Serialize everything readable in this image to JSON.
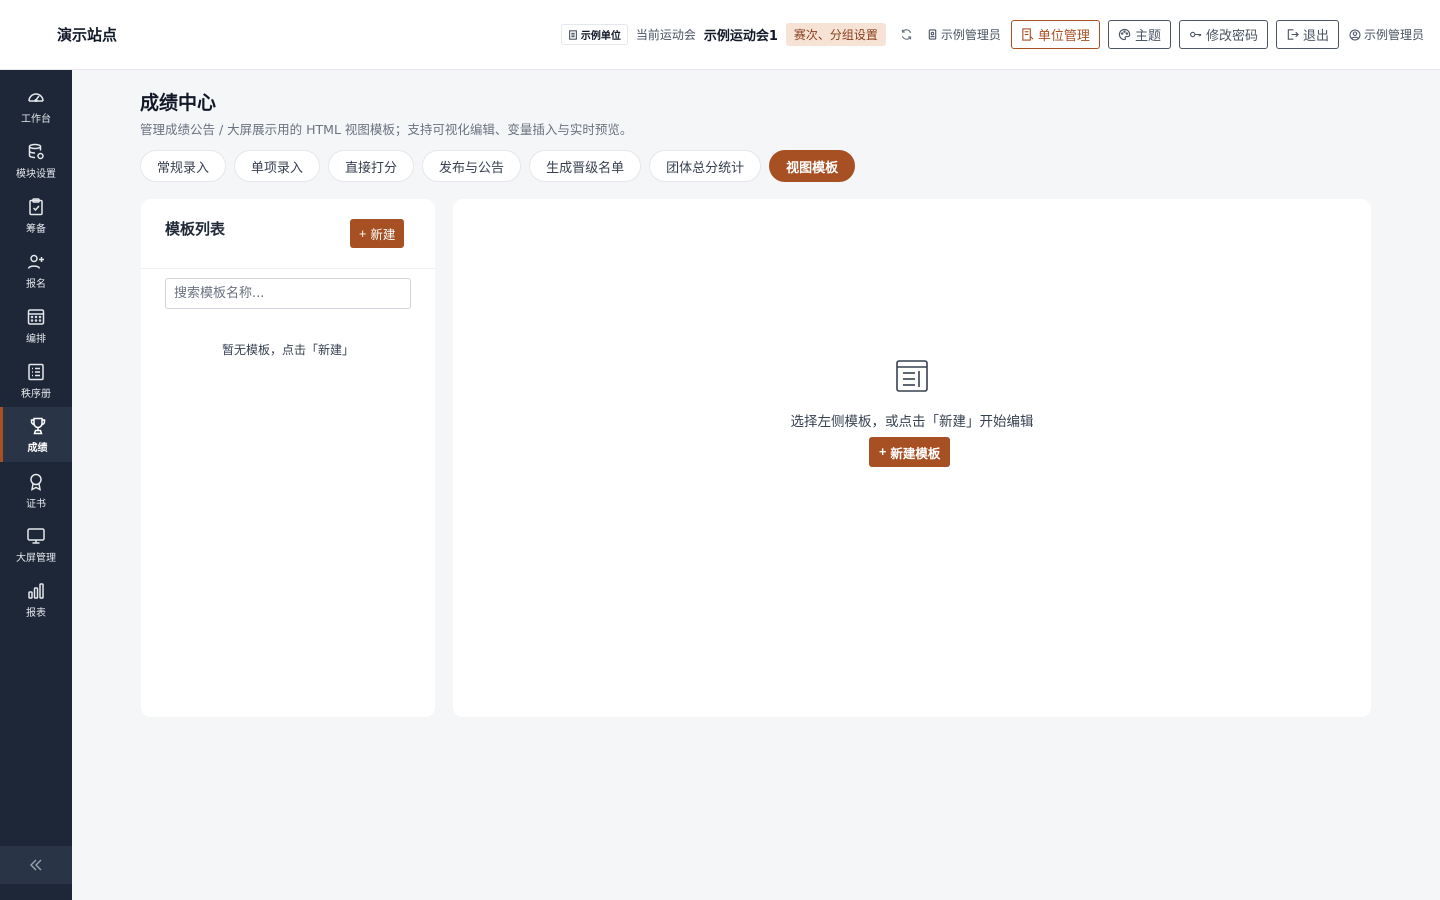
{
  "header": {
    "site_name": "演示站点",
    "unit_chip": "示例单位",
    "current_meet_label": "当前运动会",
    "current_meet_name": "示例运动会1",
    "round_chip": "赛次、分组设置",
    "admin_link": "示例管理员",
    "btn_unit_manage": "单位管理",
    "btn_theme": "主题",
    "btn_change_password": "修改密码",
    "btn_logout": "退出",
    "user_name": "示例管理员"
  },
  "sidebar": {
    "items": [
      {
        "label": "工作台",
        "icon": "dashboard-icon"
      },
      {
        "label": "模块设置",
        "icon": "database-icon"
      },
      {
        "label": "筹备",
        "icon": "clipboard-icon"
      },
      {
        "label": "报名",
        "icon": "user-plus-icon"
      },
      {
        "label": "编排",
        "icon": "calendar-icon"
      },
      {
        "label": "秩序册",
        "icon": "list-icon"
      },
      {
        "label": "成绩",
        "icon": "trophy-icon",
        "active": true
      },
      {
        "label": "证书",
        "icon": "award-icon"
      },
      {
        "label": "大屏管理",
        "icon": "monitor-icon"
      },
      {
        "label": "报表",
        "icon": "bar-chart-icon"
      }
    ],
    "collapse_icon": "double-chevron-left-icon"
  },
  "page": {
    "title": "成绩中心",
    "description": "管理成绩公告 / 大屏展示用的 HTML 视图模板；支持可视化编辑、变量插入与实时预览。"
  },
  "tabs": [
    {
      "label": "常规录入"
    },
    {
      "label": "单项录入"
    },
    {
      "label": "直接打分"
    },
    {
      "label": "发布与公告"
    },
    {
      "label": "生成晋级名单"
    },
    {
      "label": "团体总分统计"
    },
    {
      "label": "视图模板",
      "active": true
    }
  ],
  "template_list": {
    "title": "模板列表",
    "new_button": "新建",
    "search_placeholder": "搜索模板名称...",
    "empty_text": "暂无模板，点击「新建」"
  },
  "editor": {
    "empty_text": "选择左侧模板，或点击「新建」开始编辑",
    "new_template_button": "新建模板"
  },
  "colors": {
    "accent": "#a75023",
    "sidebar_bg": "#1d2738",
    "page_bg": "#f5f6f8"
  }
}
